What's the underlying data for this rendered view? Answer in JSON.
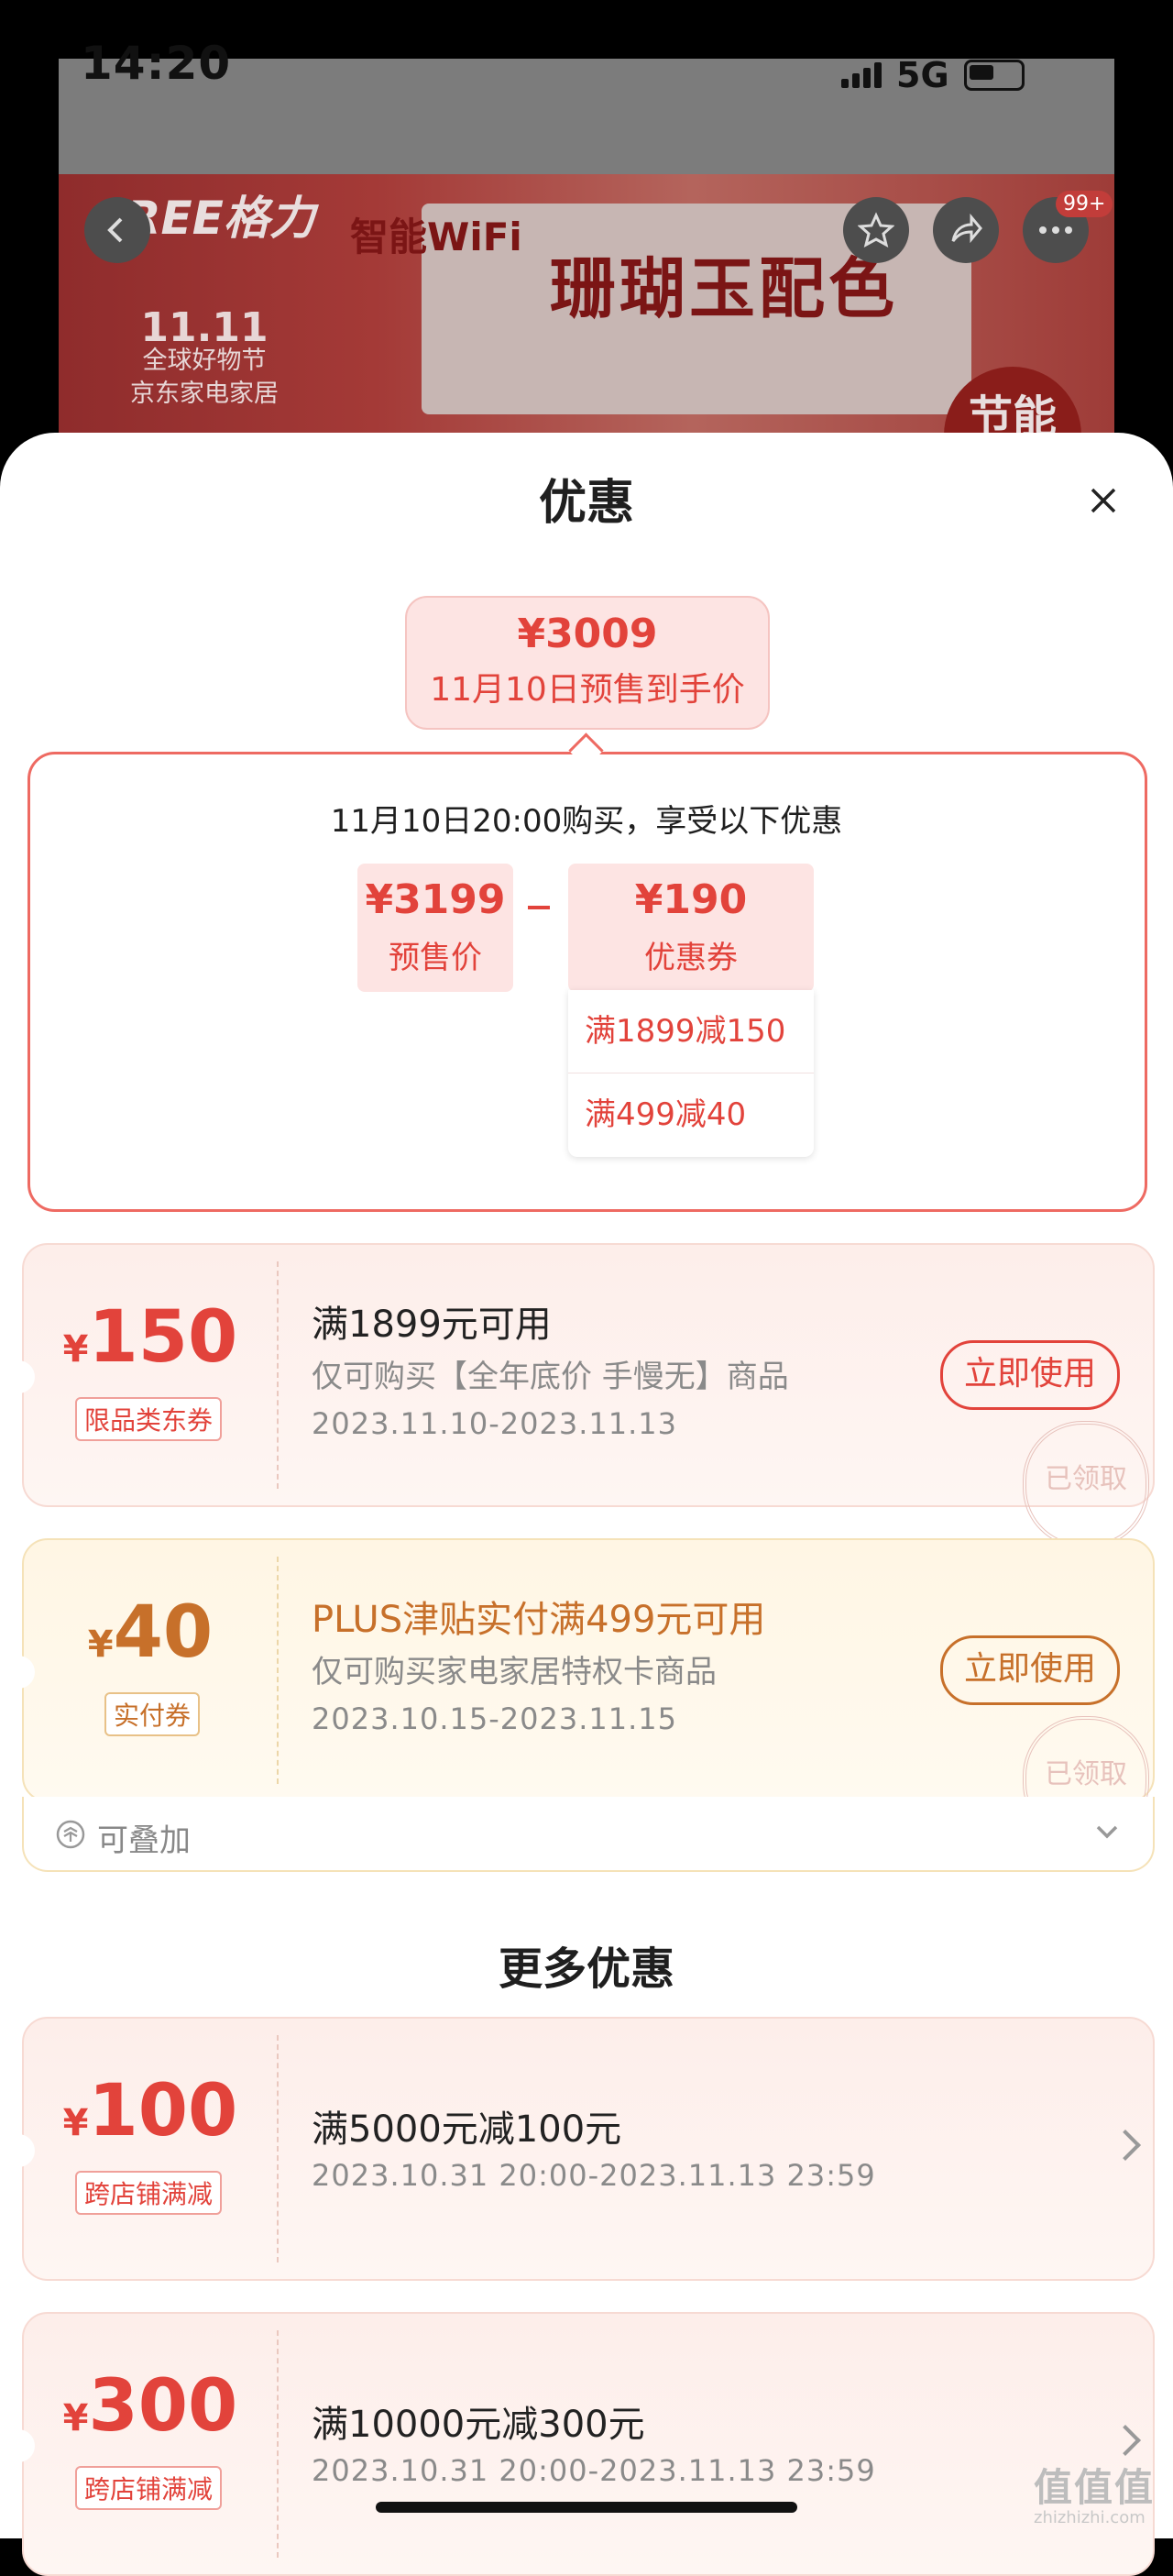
{
  "status_bar": {
    "time": "14:20",
    "network": "5G"
  },
  "product_banner": {
    "brand": "GREE格力",
    "promo_title": "11.11",
    "promo_line1": "全球好物节",
    "promo_line2": "京东家电家居",
    "feature_small": "智能WiFi",
    "feature_big": "珊瑚玉配色",
    "energy_badge": "节能",
    "cart_badge": "99+"
  },
  "sheet": {
    "title": "优惠"
  },
  "final_price": {
    "price": "¥3009",
    "label": "11月10日预售到手价"
  },
  "breakdown": {
    "heading": "11月10日20:00购买，享受以下优惠",
    "presale_value": "¥3199",
    "presale_label": "预售价",
    "coupon_value": "¥190",
    "coupon_label": "优惠券",
    "coupon_items": [
      "满1899减150",
      "满499减40"
    ]
  },
  "coupons": [
    {
      "currency": "¥",
      "amount": "150",
      "tag": "限品类东券",
      "title": "满1899元可用",
      "desc": "仅可购买【全年底价 手慢无】商品",
      "date": "2023.11.10-2023.11.13",
      "button": "立即使用",
      "stamp": "已领取"
    },
    {
      "currency": "¥",
      "amount": "40",
      "tag": "实付券",
      "title": "PLUS津贴实付满499元可用",
      "desc": "仅可购买家电家居特权卡商品",
      "date": "2023.10.15-2023.11.15",
      "button": "立即使用",
      "stamp": "已领取",
      "stack_label": "可叠加"
    }
  ],
  "more_section": {
    "title": "更多优惠"
  },
  "more_offers": [
    {
      "currency": "¥",
      "amount": "100",
      "tag": "跨店铺满减",
      "title": "满5000元减100元",
      "date": "2023.10.31 20:00-2023.11.13 23:59"
    },
    {
      "currency": "¥",
      "amount": "300",
      "tag": "跨店铺满减",
      "title": "满10000元减300元",
      "date": "2023.10.31 20:00-2023.11.13 23:59"
    }
  ],
  "watermark": {
    "text": "值值值",
    "sub": "zhizhizhi.com"
  },
  "colors": {
    "accent_red": "#e2433b",
    "gold": "#c7702a"
  }
}
